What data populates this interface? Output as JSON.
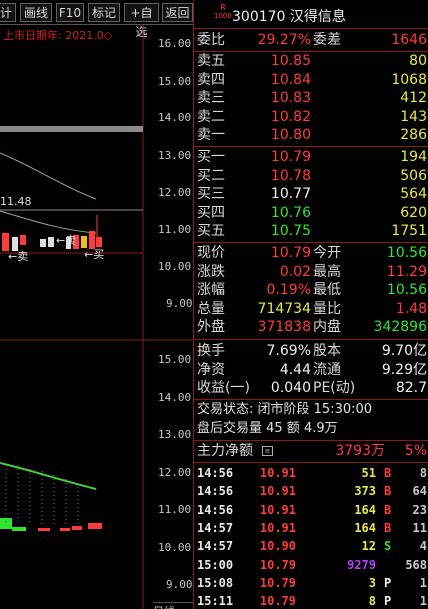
{
  "toolbar": {
    "buttons": [
      "计",
      "画线",
      "F10",
      "标记",
      "+自选",
      "返回"
    ]
  },
  "chart": {
    "ipo_label": "上市日期年: 2021.0◇",
    "price_axis": [
      "16.00",
      "15.00",
      "14.00",
      "13.00",
      "12.00",
      "11.00",
      "10.00",
      "9.00"
    ],
    "ma_value": "11.48",
    "sell_mark": "卖",
    "buy_mark": "买",
    "volume_axis": [
      "15.00",
      "14.00",
      "13.00",
      "12.00",
      "11.00",
      "10.00",
      "9.00"
    ],
    "colors": {
      "up": "#ff3b3b",
      "down": "#2ee62e",
      "ma": "#3fcf3f"
    }
  },
  "quote": {
    "exchange_badge": "R",
    "exchange_sub": "1000",
    "code": "300170",
    "name": "汉得信息",
    "ratio_label": "委比",
    "ratio_value": "29.27%",
    "diff_label": "委差",
    "diff_value": "1646",
    "asks": [
      {
        "label": "卖五",
        "price": "10.85",
        "vol": "80"
      },
      {
        "label": "卖四",
        "price": "10.84",
        "vol": "1068"
      },
      {
        "label": "卖三",
        "price": "10.83",
        "vol": "412"
      },
      {
        "label": "卖二",
        "price": "10.82",
        "vol": "143"
      },
      {
        "label": "卖一",
        "price": "10.80",
        "vol": "286"
      }
    ],
    "bids": [
      {
        "label": "买一",
        "price": "10.79",
        "vol": "194"
      },
      {
        "label": "买二",
        "price": "10.78",
        "vol": "506"
      },
      {
        "label": "买三",
        "price": "10.77",
        "vol": "564"
      },
      {
        "label": "买四",
        "price": "10.76",
        "vol": "620"
      },
      {
        "label": "买五",
        "price": "10.75",
        "vol": "1751"
      }
    ],
    "stats": [
      {
        "l1": "现价",
        "v1": "10.79",
        "l2": "今开",
        "v2": "10.56"
      },
      {
        "l1": "涨跌",
        "v1": "0.02",
        "l2": "最高",
        "v2": "11.29"
      },
      {
        "l1": "涨幅",
        "v1": "0.19%",
        "l2": "最低",
        "v2": "10.56"
      },
      {
        "l1": "总量",
        "v1": "714734",
        "l2": "量比",
        "v2": "1.48"
      },
      {
        "l1": "外盘",
        "v1": "371838",
        "l2": "内盘",
        "v2": "342896"
      }
    ],
    "finance": [
      {
        "l1": "换手",
        "v1": "7.69%",
        "l2": "股本",
        "v2": "9.70亿"
      },
      {
        "l1": "净资",
        "v1": "4.44",
        "l2": "流通",
        "v2": "9.29亿"
      },
      {
        "l1": "收益(一)",
        "v1": "0.040",
        "l2": "PE(动)",
        "v2": "82.7"
      }
    ],
    "trade_status": "交易状态: 闭市阶段 15:30:00",
    "after_hours": "盘后交易量 45 额 4.9万",
    "main_net_label": "主力净额",
    "main_net_value": "3793万",
    "main_net_pct": "5%",
    "ticks": [
      {
        "time": "14:56",
        "price": "10.91",
        "vol": "51",
        "side": "B",
        "n": "8"
      },
      {
        "time": "14:56",
        "price": "10.91",
        "vol": "373",
        "side": "B",
        "n": "64"
      },
      {
        "time": "14:56",
        "price": "10.91",
        "vol": "164",
        "side": "B",
        "n": "23"
      },
      {
        "time": "14:57",
        "price": "10.91",
        "vol": "164",
        "side": "B",
        "n": "11"
      },
      {
        "time": "14:57",
        "price": "10.90",
        "vol": "12",
        "side": "S",
        "n": "4"
      },
      {
        "time": "15:00",
        "price": "10.79",
        "vol": "9279",
        "side": "",
        "n": "568"
      },
      {
        "time": "15:08",
        "price": "10.79",
        "vol": "3",
        "side": "P",
        "n": "1"
      },
      {
        "time": "15:11",
        "price": "10.79",
        "vol": "8",
        "side": "P",
        "n": "1"
      }
    ],
    "bottom_tab": "日线"
  }
}
